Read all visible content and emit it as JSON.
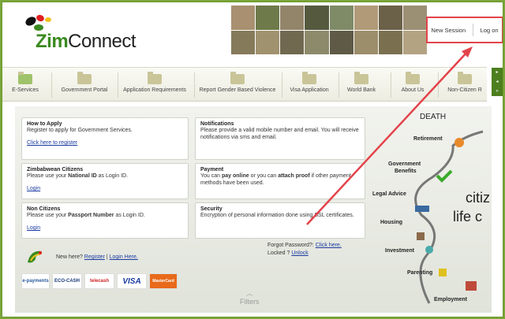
{
  "header": {
    "logo_prefix": "Zim",
    "logo_suffix": "Connect",
    "new_session": "New Session",
    "log_on": "Log on"
  },
  "nav": {
    "items": [
      {
        "label": "E-Services"
      },
      {
        "label": "Government Portal"
      },
      {
        "label": "Application Requirements"
      },
      {
        "label": "Report Gender Based Violence"
      },
      {
        "label": "Visa Application"
      },
      {
        "label": "World Bank"
      },
      {
        "label": "About Us"
      },
      {
        "label": "Non-Citizen R"
      }
    ]
  },
  "cards": {
    "how_to_apply": {
      "title": "How to Apply",
      "text": "Register to apply for Government Services.",
      "link": "Click here to register"
    },
    "notifications": {
      "title": "Notifications",
      "text": "Please provide a valid mobile number and email. You will receive notifications via sms and email."
    },
    "zim_citizens": {
      "title": "Zimbabwean Citizens",
      "text_pre": "Please use your ",
      "text_bold": "National ID",
      "text_post": " as Login ID.",
      "link": "Login"
    },
    "payment": {
      "title": "Payment",
      "text_pre": "You can ",
      "bold1": "pay online",
      "text_mid": " or you can ",
      "bold2": "attach proof",
      "text_post": " if other payment methods have been used."
    },
    "non_citizens": {
      "title": "Non Citizens",
      "text_pre": "Please use your ",
      "text_bold": "Passport Number",
      "text_post": " as Login ID.",
      "link": "Login"
    },
    "security": {
      "title": "Security",
      "text": "Encryption of personal information done using SSL certificates."
    }
  },
  "register": {
    "prefix": "New here? ",
    "register": "Register",
    "sep": " | ",
    "login_here": "Login Here."
  },
  "forgot": {
    "forgot_label": "Forgot Password?: ",
    "click_here": "Click here.",
    "locked_label": "Locked ? ",
    "unlock": "Unlock"
  },
  "filters": "Filters",
  "payments": [
    "e-payments",
    "ECO-CASH",
    "telecash",
    "VISA",
    "MasterCard"
  ],
  "life_cycle": {
    "death": "DEATH",
    "retirement": "Retirement",
    "gov_benefits_1": "Government",
    "gov_benefits_2": "Benefits",
    "legal_advice": "Legal Advice",
    "housing": "Housing",
    "investment": "Investment",
    "parenting": "Parenting",
    "employment": "Employment",
    "big1": "citiz",
    "big2": "life c"
  },
  "colors": {
    "accent_green": "#3a8a1f",
    "highlight_red": "#e3434a",
    "link_blue": "#1a3aa0"
  }
}
